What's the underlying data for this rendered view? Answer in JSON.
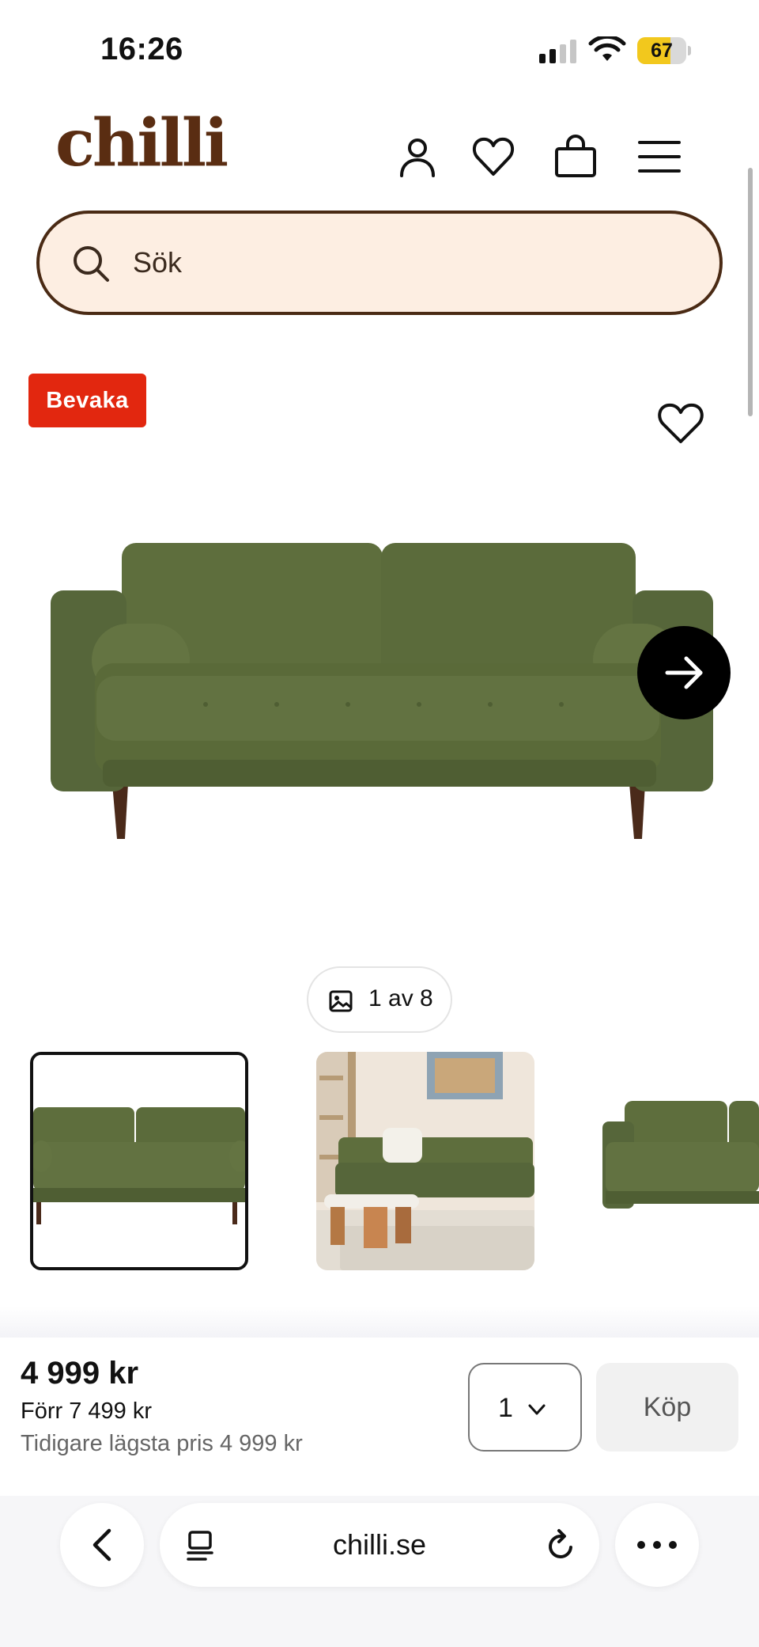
{
  "status_bar": {
    "time": "16:26",
    "battery_level": "67",
    "battery_fraction": 0.67,
    "battery_color": "#f2c81d"
  },
  "header": {
    "logo": "chilli",
    "brand_color": "#5a2d12",
    "icons": [
      "account-icon",
      "heart-icon",
      "shopping-bag-icon",
      "menu-icon"
    ]
  },
  "search": {
    "placeholder": "Sök",
    "background": "#fdeee2"
  },
  "product": {
    "badge": "Bevaka",
    "badge_color": "#e2270f",
    "sofa_color": "#5e6e3d",
    "image_counter": "1 av 8",
    "thumbnails_visible": 3,
    "selected_thumbnail": 1
  },
  "purchase": {
    "price": "4 999 kr",
    "before_price": "Förr 7 499 kr",
    "lowest_price": "Tidigare lägsta pris 4 999 kr",
    "quantity": "1",
    "buy_label": "Köp"
  },
  "browser": {
    "url": "chilli.se"
  }
}
